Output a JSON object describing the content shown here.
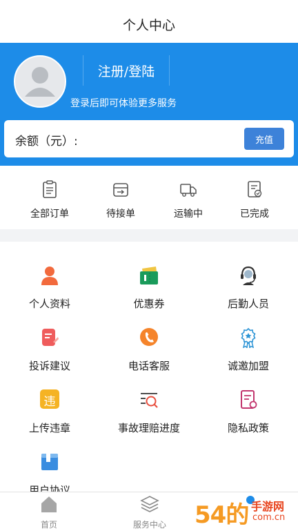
{
  "header": {
    "title": "个人中心"
  },
  "profile": {
    "login_label": "注册/登陆",
    "hint": "登录后即可体验更多服务"
  },
  "balance": {
    "label": "余额（元）:",
    "recharge_label": "充值"
  },
  "orders": [
    {
      "label": "全部订单",
      "icon": "clipboard-icon"
    },
    {
      "label": "待接单",
      "icon": "inbox-arrow-icon"
    },
    {
      "label": "运输中",
      "icon": "truck-icon"
    },
    {
      "label": "已完成",
      "icon": "check-document-icon"
    }
  ],
  "services": [
    {
      "label": "个人资料",
      "icon": "person-icon",
      "color": "#f26a3d"
    },
    {
      "label": "优惠券",
      "icon": "coupon-icon",
      "color": "#1a9b5b"
    },
    {
      "label": "后勤人员",
      "icon": "headset-icon",
      "color": "#333333"
    },
    {
      "label": "投诉建议",
      "icon": "feedback-icon",
      "color": "#ef5c5c"
    },
    {
      "label": "电话客服",
      "icon": "phone-icon",
      "color": "#f5842b"
    },
    {
      "label": "诚邀加盟",
      "icon": "award-icon",
      "color": "#2a93d5"
    },
    {
      "label": "上传违章",
      "icon": "violation-icon",
      "violation_char": "违",
      "color": "#f5b324"
    },
    {
      "label": "事故理赔进度",
      "icon": "progress-search-icon",
      "color": "#e84d3d"
    },
    {
      "label": "隐私政策",
      "icon": "policy-icon",
      "color": "#c2366e"
    },
    {
      "label": "用户协议",
      "icon": "book-icon",
      "color": "#3a8de0"
    }
  ],
  "tabbar": [
    {
      "label": "首页",
      "icon": "home-icon"
    },
    {
      "label": "服务中心",
      "icon": "layers-icon"
    },
    {
      "label": "",
      "icon": "profile-tab-icon"
    }
  ],
  "watermark": {
    "logo_text": "54的",
    "site_text": "手游网",
    "domain_text": "com.cn"
  },
  "colors": {
    "primary": "#1d8ce8",
    "button": "#3d82d9"
  }
}
